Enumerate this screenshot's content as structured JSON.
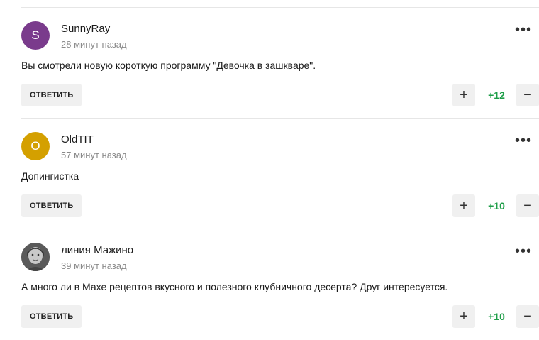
{
  "comments": [
    {
      "author": "SunnyRay",
      "avatar_letter": "S",
      "avatar_color": "#7a3b8c",
      "time": "28 минут назад",
      "text": "Вы смотрели новую короткую программу \"Девочка в зашкваре\".",
      "reply_label": "ОТВЕТИТЬ",
      "score": "+12",
      "more_icon": "more-dots-icon"
    },
    {
      "author": "OldTIT",
      "avatar_letter": "O",
      "avatar_color": "#d4a000",
      "time": "57 минут назад",
      "text": "Допингистка",
      "reply_label": "ОТВЕТИТЬ",
      "score": "+10",
      "more_icon": "more-dots-icon"
    },
    {
      "author": "линия Мажино",
      "avatar_letter": "",
      "avatar_color": "#6d6d6d",
      "time": "39 минут назад",
      "text": "А много ли в Махе рецептов вкусного и полезного клубничного десерта? Друг интересуется.",
      "reply_label": "ОТВЕТИТЬ",
      "score": "+10",
      "more_icon": "more-dots-icon"
    }
  ],
  "vote": {
    "plus": "+",
    "minus": "−"
  },
  "colors": {
    "score_positive": "#1e9e48",
    "button_bg": "#f0f0f0",
    "divider": "#e6e6e6"
  }
}
